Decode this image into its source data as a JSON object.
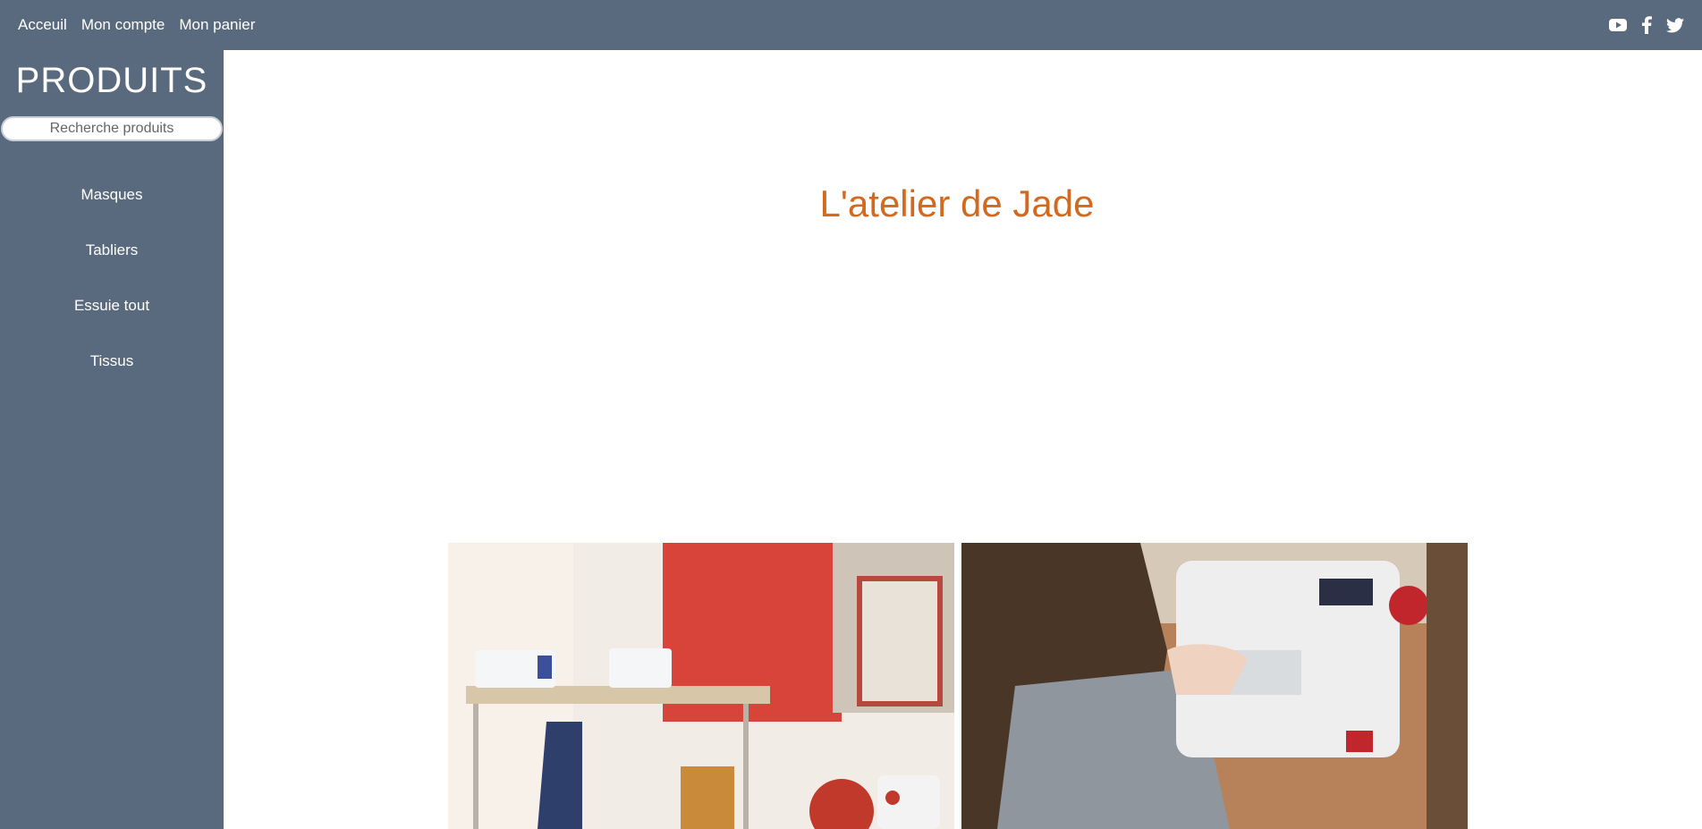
{
  "topnav": {
    "items": [
      "Acceuil",
      "Mon compte",
      "Mon panier"
    ]
  },
  "social": {
    "icons": [
      "youtube-icon",
      "facebook-icon",
      "twitter-icon"
    ]
  },
  "sidebar": {
    "title": "PRODUITS",
    "search_placeholder": "Recherche produits",
    "items": [
      "Masques",
      "Tabliers",
      "Essuie tout",
      "Tissus"
    ]
  },
  "main": {
    "title": "L'atelier de Jade"
  },
  "colors": {
    "bar": "#5a6a7e",
    "accent": "#d2691e",
    "wall": "#d9443a"
  }
}
